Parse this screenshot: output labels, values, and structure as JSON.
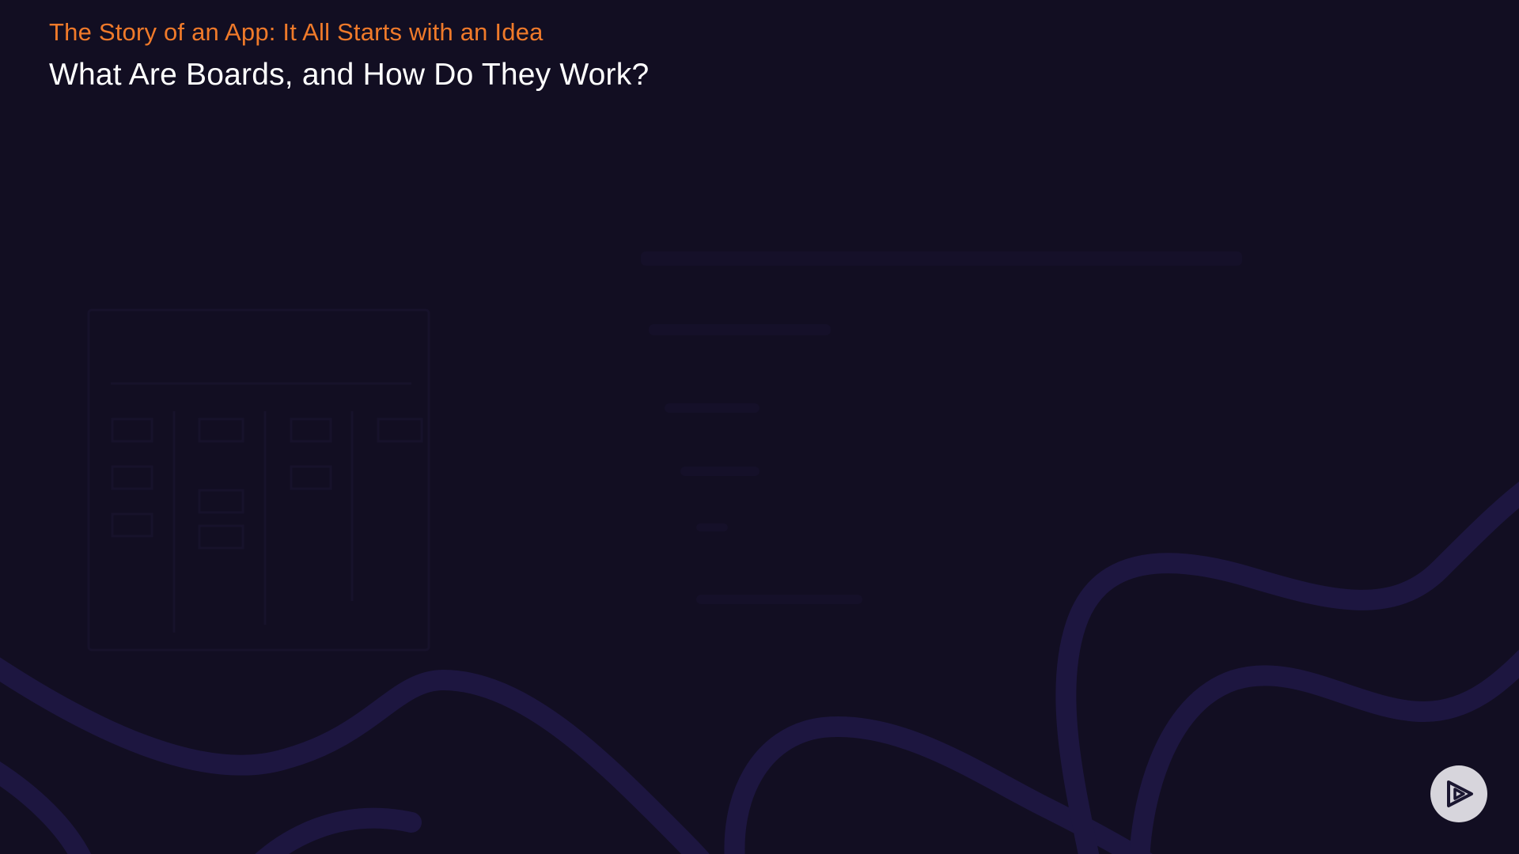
{
  "header": {
    "subtitle": "The Story of an App: It All Starts with an Idea",
    "title": "What Are Boards, and How Do They Work?"
  },
  "controls": {
    "play_icon": "play-logo-icon"
  },
  "colors": {
    "background": "#120e22",
    "subtitle": "#f07a2a",
    "title": "#ffffff",
    "wave": "#1d1640",
    "play_button": "#d7d5dc",
    "play_glyph": "#1a1630"
  }
}
